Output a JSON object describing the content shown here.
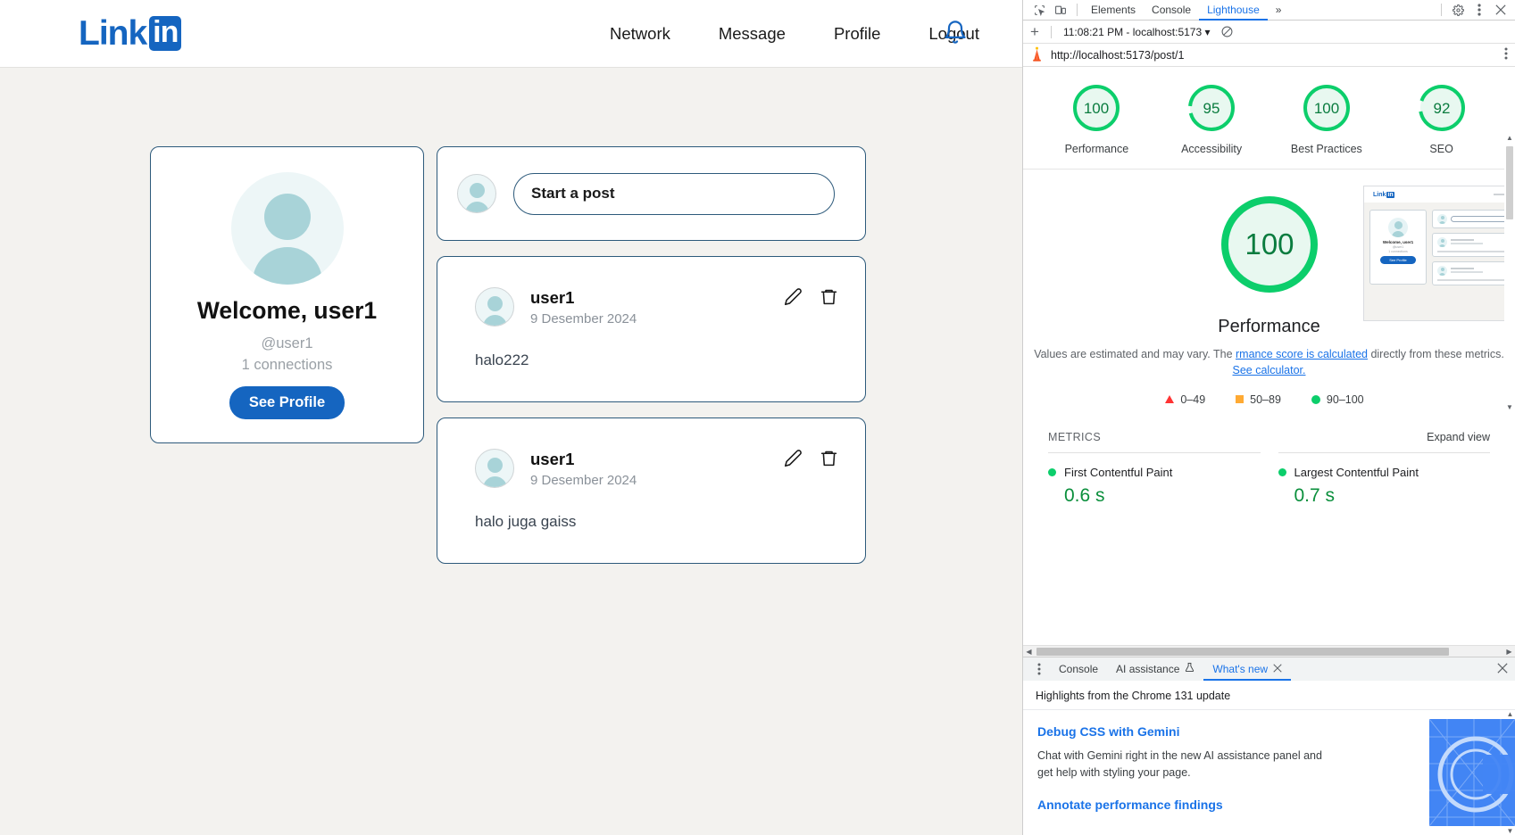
{
  "webpage": {
    "brand": {
      "word": "Link",
      "badge": "in"
    },
    "nav": [
      {
        "label": "Network"
      },
      {
        "label": "Message"
      },
      {
        "label": "Profile"
      },
      {
        "label": "Logout"
      }
    ],
    "bell_icon": "bell-icon",
    "profile_card": {
      "welcome": "Welcome, user1",
      "handle": "@user1",
      "connections": "1 connections",
      "button": "See Profile"
    },
    "composer": {
      "placeholder": "Start a post"
    },
    "posts": [
      {
        "author": "user1",
        "date": "9 Desember 2024",
        "body": "halo222",
        "edit_icon": "pencil-icon",
        "delete_icon": "trash-icon"
      },
      {
        "author": "user1",
        "date": "9 Desember 2024",
        "body": "halo juga gaiss",
        "edit_icon": "pencil-icon",
        "delete_icon": "trash-icon"
      }
    ]
  },
  "devtools": {
    "tabs": [
      {
        "label": "Elements",
        "active": false
      },
      {
        "label": "Console",
        "active": false
      },
      {
        "label": "Lighthouse",
        "active": true
      }
    ],
    "more_tabs": "»",
    "settings_icon": "gear-icon",
    "kebab_icon": "more-vertical-icon",
    "close_icon": "close-icon",
    "inspect_icon": "inspect-element-icon",
    "device_icon": "device-toolbar-icon",
    "lighthouse": {
      "new_report": "+",
      "run_label": "11:08:21 PM - localhost:5173",
      "clear_icon": "no-entry-icon",
      "url": "http://localhost:5173/post/1",
      "row_kebab": "more-vertical-icon",
      "lighthouse_icon": "lighthouse-icon",
      "gauges": [
        {
          "score": "100",
          "label": "Performance"
        },
        {
          "score": "95",
          "label": "Accessibility"
        },
        {
          "score": "100",
          "label": "Best Practices"
        },
        {
          "score": "92",
          "label": "SEO"
        }
      ],
      "hero": {
        "score": "100",
        "title": "Performance",
        "note_1": "Values are estimated and may vary. The ",
        "note_link": "rmance score is calculated",
        "note_2": " directly from these metrics. ",
        "note_link2": "See calculator."
      },
      "legend": [
        {
          "range": "0–49",
          "swatch": "triangle"
        },
        {
          "range": "50–89",
          "swatch": "square"
        },
        {
          "range": "90–100",
          "swatch": "circle"
        }
      ],
      "metrics_title": "METRICS",
      "expand_view": "Expand view",
      "metrics": [
        {
          "name": "First Contentful Paint",
          "value": "0.6 s"
        },
        {
          "name": "Largest Contentful Paint",
          "value": "0.7 s"
        }
      ]
    },
    "drawer": {
      "kebab_icon": "more-vertical-icon",
      "tabs": [
        {
          "label": "Console",
          "active": false,
          "icon": ""
        },
        {
          "label": "AI assistance",
          "active": false,
          "icon": "flask-icon"
        },
        {
          "label": "What's new",
          "active": true,
          "icon": ""
        }
      ],
      "tab_close_icon": "close-icon",
      "drawer_close_icon": "close-icon",
      "whats_new": {
        "subtitle": "Highlights from the Chrome 131 update",
        "heading_1": "Debug CSS with Gemini",
        "paragraph_1": "Chat with Gemini right in the new AI assistance panel and get help with styling your page.",
        "heading_2": "Annotate performance findings"
      }
    }
  },
  "colors": {
    "brand_blue": "#1565c0",
    "card_border": "#2d5a7b",
    "page_bg": "#f3f2ef",
    "score_green": "#0cce6b",
    "devtools_accent": "#1a73e8",
    "muted_text": "#9aa0a6"
  }
}
